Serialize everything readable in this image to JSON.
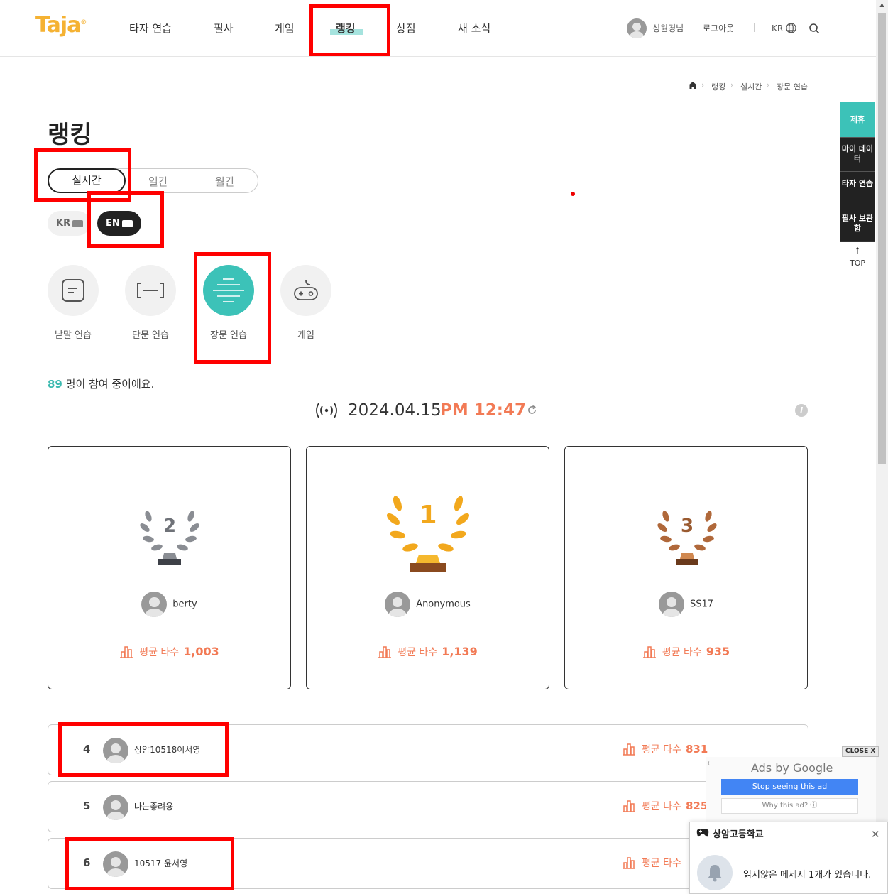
{
  "header": {
    "logo": "Taja",
    "logo_mark": "®",
    "nav": [
      "타자 연습",
      "필사",
      "게임",
      "랭킹",
      "상점",
      "새 소식"
    ],
    "user_name": "성원경님",
    "logout": "로그아웃",
    "lang": "KR"
  },
  "breadcrumb": [
    "랭킹",
    "실시간",
    "장문 연습"
  ],
  "page_title": "랭킹",
  "period_tabs": [
    "실시간",
    "일간",
    "월간"
  ],
  "lang_toggle": [
    "KR",
    "EN"
  ],
  "categories": [
    "낱말 연습",
    "단문 연습",
    "장문 연습",
    "게임"
  ],
  "participants": {
    "count": "89",
    "text": " 명이 참여 중이에요."
  },
  "datetime": {
    "date": "2024.04.15",
    "time": "PM 12:47"
  },
  "score_label": "평균 타수",
  "top3": [
    {
      "rank": "2",
      "name": "berty",
      "score": "1,003"
    },
    {
      "rank": "1",
      "name": "Anonymous",
      "score": "1,139"
    },
    {
      "rank": "3",
      "name": "SS17",
      "score": "935"
    }
  ],
  "rows": [
    {
      "rank": "4",
      "name": "상암10518이서영",
      "score": "831"
    },
    {
      "rank": "5",
      "name": "나는좋려용",
      "score": "825"
    },
    {
      "rank": "6",
      "name": "10517 윤서영",
      "score": ""
    }
  ],
  "side_menu": [
    "제휴",
    "마이 데이터",
    "타자 연습",
    "필사 보관함",
    "TOP"
  ],
  "ad": {
    "close": "CLOSE X",
    "ads_by": "Ads by Google",
    "stop": "Stop seeing this ad",
    "why": "Why this ad? ⓘ"
  },
  "notification": {
    "school": "상암고등학교",
    "message": "읽지않은 메세지 1개가 있습니다."
  },
  "colors": {
    "accent": "#3cc2b8",
    "score": "#f27a55",
    "highlight": "#ff0000",
    "gold": "#f2a81d",
    "silver": "#8a8d93",
    "bronze": "#b0683a"
  }
}
